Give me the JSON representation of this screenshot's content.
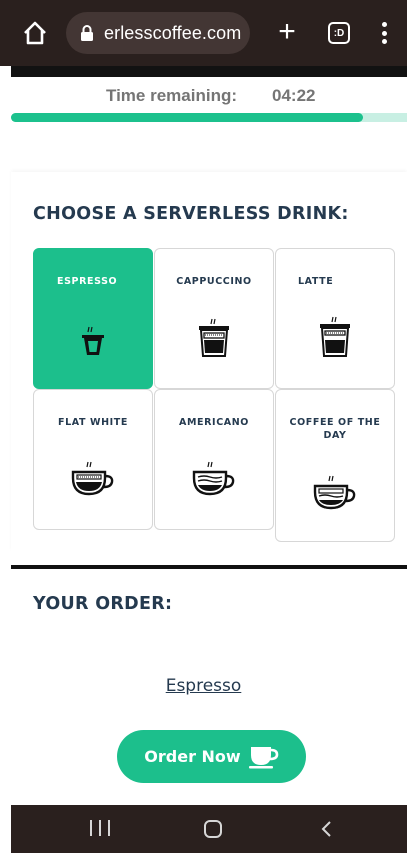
{
  "browser": {
    "url": "erlesscoffee.com",
    "plus_label": "+",
    "tabs_label": ":D"
  },
  "timer": {
    "label": "Time remaining:",
    "value": "04:22",
    "progress_fraction": 0.89
  },
  "drinks": {
    "heading": "CHOOSE A SERVERLESS DRINK:",
    "items": [
      {
        "label": "ESPRESSO",
        "selected": true,
        "icon": "espresso-cup-icon"
      },
      {
        "label": "CAPPUCCINO",
        "selected": false,
        "icon": "cappuccino-cup-icon"
      },
      {
        "label": "LATTE",
        "selected": false,
        "icon": "latte-cup-icon"
      },
      {
        "label": "FLAT WHITE",
        "selected": false,
        "icon": "flat-white-cup-icon"
      },
      {
        "label": "AMERICANO",
        "selected": false,
        "icon": "americano-cup-icon"
      },
      {
        "label": "COFFEE OF THE DAY",
        "selected": false,
        "icon": "coffee-of-the-day-cup-icon"
      }
    ]
  },
  "order": {
    "heading": "YOUR ORDER:",
    "item": "Espresso",
    "button_label": "Order Now"
  },
  "colors": {
    "accent": "#1cbf8c",
    "heading": "#253a4f",
    "chrome": "#2a201e"
  }
}
